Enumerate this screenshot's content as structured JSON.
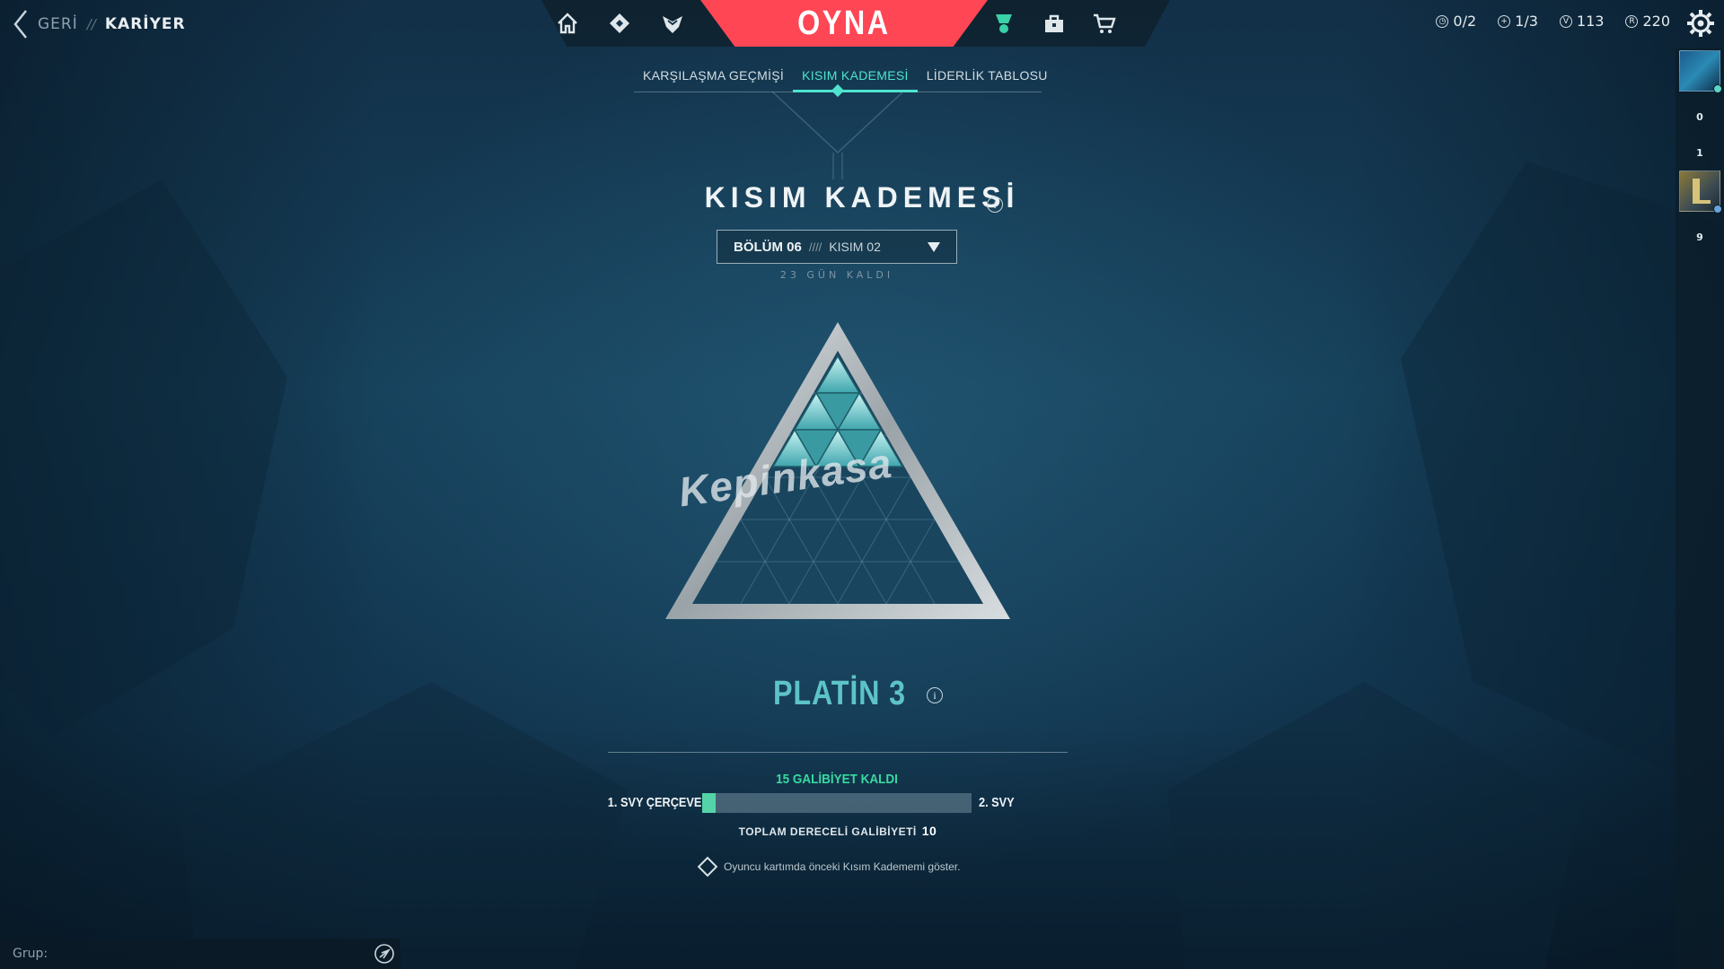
{
  "header": {
    "back_label": "GERİ",
    "breadcrumb_sep": "//",
    "current_page": "KARİYER"
  },
  "nav": {
    "play_label": "OYNA",
    "icons": [
      "home-icon",
      "agents-icon",
      "collection-icon",
      "battlepass-icon",
      "career-icon",
      "store-icon"
    ]
  },
  "currencies": {
    "timer": "0/2",
    "plus": "1/3",
    "vp": "113",
    "rp": "220"
  },
  "tabs": [
    {
      "label": "KARŞILAŞMA GEÇMİŞİ",
      "active": false
    },
    {
      "label": "KISIM KADEMESİ",
      "active": true
    },
    {
      "label": "LİDERLİK TABLOSU",
      "active": false
    }
  ],
  "page_title": "KISIM KADEMESİ",
  "info_glyph": "i",
  "selector": {
    "episode": "BÖLÜM 06",
    "separator": "////",
    "act": "KISIM 02"
  },
  "days_left": "23 GÜN KALDI",
  "rank": {
    "name": "PLATİN 3",
    "color": "#5dc3c8"
  },
  "progress": {
    "wins_left_text": "15 GALİBİYET KALDI",
    "left_label": "1. SVY ÇERÇEVE",
    "right_label": "2. SVY",
    "fraction": 0.05,
    "accent": "#55d3a8"
  },
  "total_wins": {
    "label": "TOPLAM DERECELİ GALİBİYETİ",
    "value": "10"
  },
  "show_checkbox_label": "Oyuncu kartımda önceki Kısım Kadememi göster.",
  "group": {
    "label": "Grup:"
  },
  "side_panel": {
    "counts": [
      "0",
      "1",
      "9"
    ]
  },
  "watermark": "Kepinkasa",
  "colors": {
    "play_red": "#ff4655",
    "accent_teal": "#4fe3cf"
  }
}
